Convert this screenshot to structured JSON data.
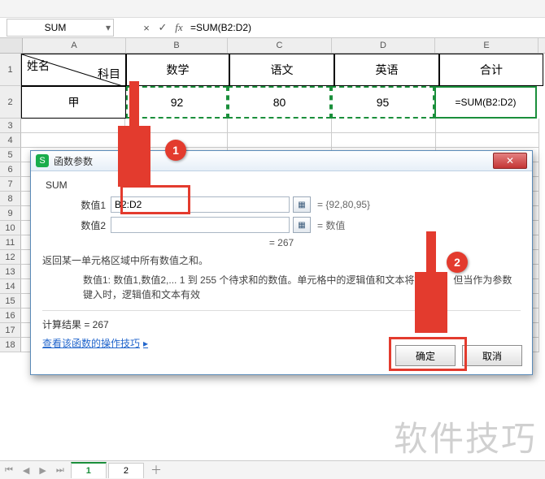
{
  "toolbar": {},
  "namebox": "SUM",
  "formula_bar": {
    "cancel_glyph": "×",
    "confirm_glyph": "✓",
    "fx_glyph": "fx",
    "value": "=SUM(B2:D2)"
  },
  "columns": [
    "A",
    "B",
    "C",
    "D",
    "E"
  ],
  "header_row": {
    "index": "1",
    "diag_top": "姓名",
    "diag_bottom": "科目",
    "b": "数学",
    "c": "语文",
    "d": "英语",
    "e": "合计"
  },
  "data_row": {
    "index": "2",
    "a": "甲",
    "b": "92",
    "c": "80",
    "d": "95",
    "e": "=SUM(B2:D2)"
  },
  "empty_rows": [
    "3",
    "4",
    "5",
    "6",
    "7",
    "8",
    "9",
    "10",
    "11",
    "12",
    "13",
    "14",
    "15",
    "16",
    "17",
    "18"
  ],
  "dialog": {
    "title": "函数参数",
    "icon_letter": "S",
    "func": "SUM",
    "params": [
      {
        "label": "数值1",
        "value": "B2:D2",
        "preview": "= {92,80,95}"
      },
      {
        "label": "数值2",
        "value": "",
        "preview": "= 数值"
      }
    ],
    "result_line": "= 267",
    "desc1": "返回某一单元格区域中所有数值之和。",
    "desc2_label": "数值1:",
    "desc2": "数值1,数值2,... 1 到 255 个待求和的数值。单元格中的逻辑值和文本将被忽略。但当作为参数键入时，逻辑值和文本有效",
    "calc_label": "计算结果 = 267",
    "help": "查看该函数的操作技巧",
    "ok": "确定",
    "cancel": "取消"
  },
  "annotations": {
    "badge1": "1",
    "badge2": "2"
  },
  "sheet_tabs": {
    "active": "1",
    "other": "2"
  },
  "watermark": "软件技巧"
}
